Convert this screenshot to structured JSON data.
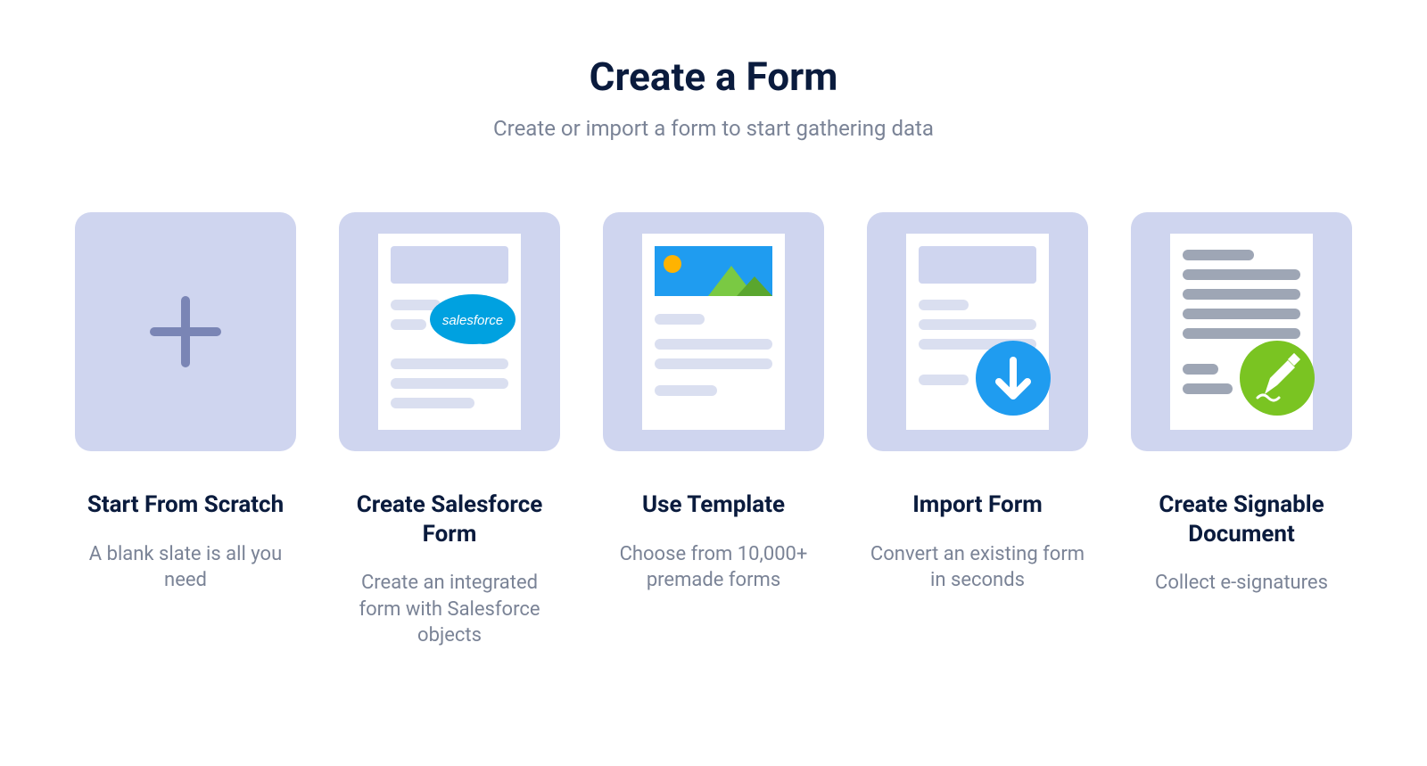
{
  "header": {
    "title": "Create a Form",
    "subtitle": "Create or import a form to start gathering data"
  },
  "options": [
    {
      "title": "Start From Scratch",
      "desc": "A blank slate is all you need"
    },
    {
      "title": "Create Salesforce Form",
      "desc": "Create an integrated form with Salesforce objects"
    },
    {
      "title": "Use Template",
      "desc": "Choose from 10,000+ premade forms"
    },
    {
      "title": "Import Form",
      "desc": "Convert an existing form in seconds"
    },
    {
      "title": "Create Signable Document",
      "desc": "Collect e-signatures"
    }
  ],
  "salesforce_label": "salesforce"
}
